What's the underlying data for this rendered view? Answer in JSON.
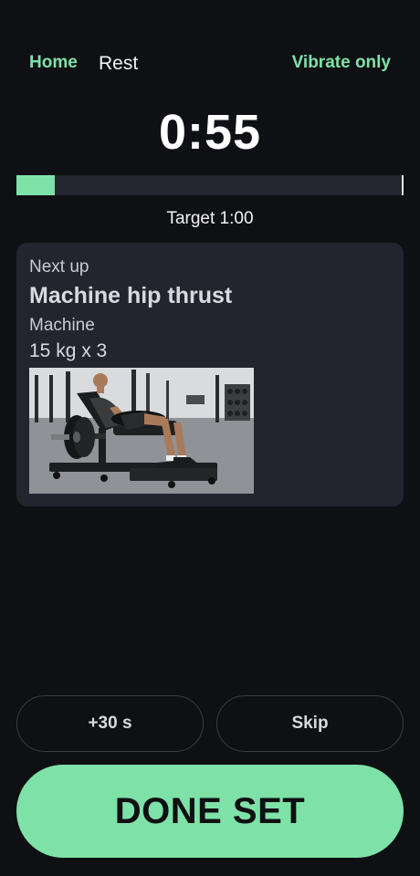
{
  "header": {
    "home_label": "Home",
    "title": "Rest",
    "vibrate_label": "Vibrate only"
  },
  "timer": {
    "display": "0:55",
    "progress_fraction": 0.1,
    "target_text": "Target 1:00"
  },
  "next_exercise": {
    "heading": "Next up",
    "name": "Machine hip thrust",
    "equipment": "Machine",
    "weight_reps": "15 kg x 3"
  },
  "actions": {
    "add_time_label": "+30 s",
    "skip_label": "Skip",
    "done_label": "DONE SET"
  },
  "colors": {
    "background": "#0f1013",
    "accent": "#7ee2a8",
    "card": "#22252d",
    "track": "#232630"
  }
}
